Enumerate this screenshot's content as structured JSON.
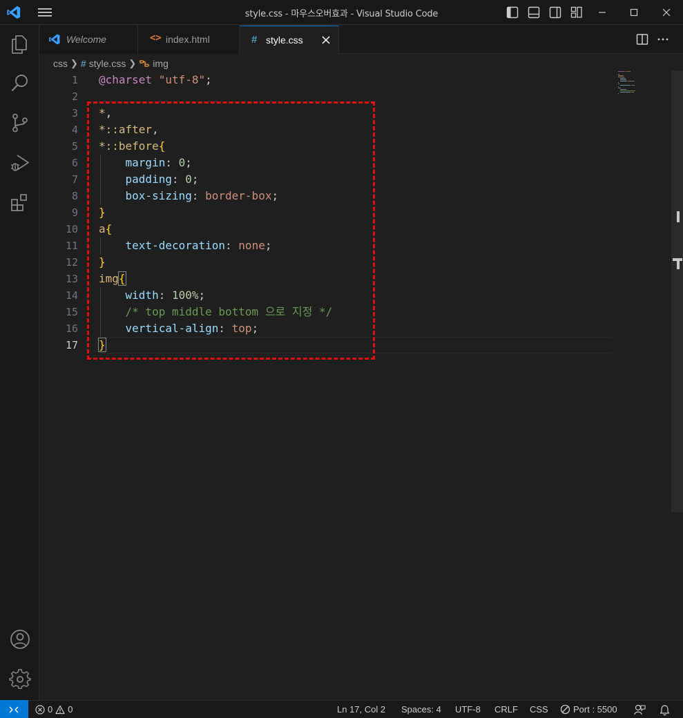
{
  "window": {
    "title": "style.css - 마우스오버효과 - Visual Studio Code"
  },
  "tabs": [
    {
      "label": "Welcome",
      "icon": "vscode-logo-icon"
    },
    {
      "label": "index.html",
      "icon": "html-icon"
    },
    {
      "label": "style.css",
      "icon": "css-hash-icon",
      "active": true
    }
  ],
  "breadcrumb": {
    "folder": "css",
    "file": "style.css",
    "symbol": "img"
  },
  "editor": {
    "line_numbers": [
      "1",
      "2",
      "3",
      "4",
      "5",
      "6",
      "7",
      "8",
      "9",
      "10",
      "11",
      "12",
      "13",
      "14",
      "15",
      "16",
      "17"
    ],
    "current_line": 17,
    "lines": [
      {
        "parts": [
          {
            "t": "@charset ",
            "c": "at"
          },
          {
            "t": "\"utf-8\"",
            "c": "str"
          },
          {
            "t": ";",
            "c": "punc"
          }
        ]
      },
      {
        "parts": []
      },
      {
        "parts": [
          {
            "t": "*",
            "c": "sel"
          },
          {
            "t": ",",
            "c": "punc"
          }
        ]
      },
      {
        "parts": [
          {
            "t": "*::after",
            "c": "sel"
          },
          {
            "t": ",",
            "c": "punc"
          }
        ]
      },
      {
        "parts": [
          {
            "t": "*::before",
            "c": "sel"
          },
          {
            "t": "{",
            "c": "br"
          }
        ]
      },
      {
        "parts": [
          {
            "t": "    ",
            "c": "punc"
          },
          {
            "t": "margin",
            "c": "prop"
          },
          {
            "t": ": ",
            "c": "punc"
          },
          {
            "t": "0",
            "c": "num"
          },
          {
            "t": ";",
            "c": "punc"
          }
        ]
      },
      {
        "parts": [
          {
            "t": "    ",
            "c": "punc"
          },
          {
            "t": "padding",
            "c": "prop"
          },
          {
            "t": ": ",
            "c": "punc"
          },
          {
            "t": "0",
            "c": "num"
          },
          {
            "t": ";",
            "c": "punc"
          }
        ]
      },
      {
        "parts": [
          {
            "t": "    ",
            "c": "punc"
          },
          {
            "t": "box-sizing",
            "c": "prop"
          },
          {
            "t": ": ",
            "c": "punc"
          },
          {
            "t": "border-box",
            "c": "val"
          },
          {
            "t": ";",
            "c": "punc"
          }
        ]
      },
      {
        "parts": [
          {
            "t": "}",
            "c": "br"
          }
        ]
      },
      {
        "parts": [
          {
            "t": "a",
            "c": "sel"
          },
          {
            "t": "{",
            "c": "br"
          }
        ]
      },
      {
        "parts": [
          {
            "t": "    ",
            "c": "punc"
          },
          {
            "t": "text-decoration",
            "c": "prop"
          },
          {
            "t": ": ",
            "c": "punc"
          },
          {
            "t": "none",
            "c": "val"
          },
          {
            "t": ";",
            "c": "punc"
          }
        ]
      },
      {
        "parts": [
          {
            "t": "}",
            "c": "br"
          }
        ]
      },
      {
        "parts": [
          {
            "t": "img",
            "c": "sel"
          },
          {
            "t": "{",
            "c": "br box"
          }
        ]
      },
      {
        "parts": [
          {
            "t": "    ",
            "c": "punc"
          },
          {
            "t": "width",
            "c": "prop"
          },
          {
            "t": ": ",
            "c": "punc"
          },
          {
            "t": "100%",
            "c": "num"
          },
          {
            "t": ";",
            "c": "punc"
          }
        ]
      },
      {
        "parts": [
          {
            "t": "    ",
            "c": "punc"
          },
          {
            "t": "/* top middle bottom 으로 지정 */",
            "c": "com"
          }
        ]
      },
      {
        "parts": [
          {
            "t": "    ",
            "c": "punc"
          },
          {
            "t": "vertical-align",
            "c": "prop"
          },
          {
            "t": ": ",
            "c": "punc"
          },
          {
            "t": "top",
            "c": "val"
          },
          {
            "t": ";",
            "c": "punc"
          }
        ]
      },
      {
        "parts": [
          {
            "t": "}",
            "c": "br box"
          }
        ]
      }
    ]
  },
  "statusbar": {
    "errors": "0",
    "warnings": "0",
    "position": "Ln 17, Col 2",
    "spaces": "Spaces: 4",
    "encoding": "UTF-8",
    "eol": "CRLF",
    "language": "CSS",
    "port": "Port : 5500"
  },
  "colors": {
    "accent": "#0078d4",
    "highlight_box": "#e01010"
  }
}
